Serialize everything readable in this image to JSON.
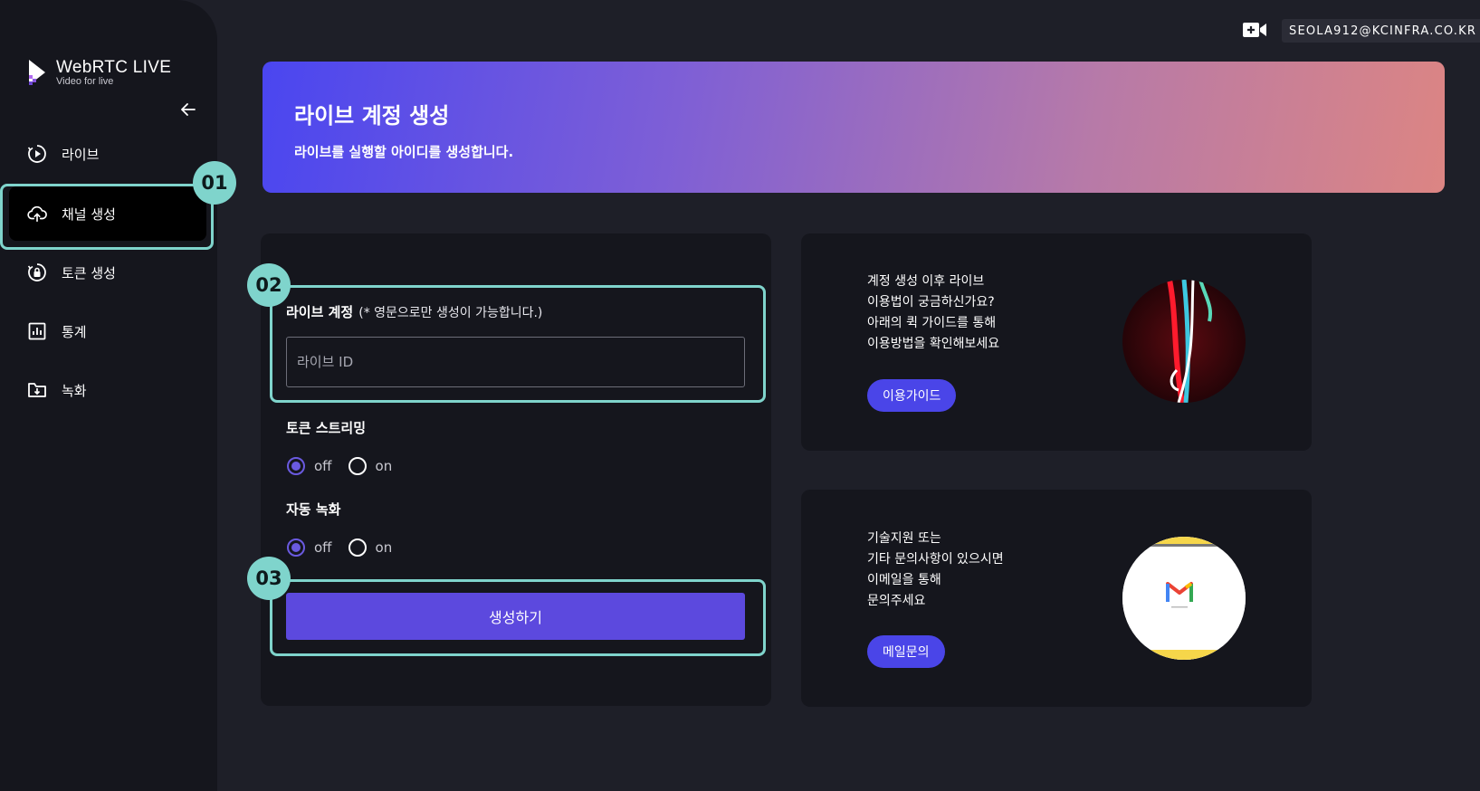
{
  "app": {
    "title": "WebRTC LIVE",
    "subtitle": "Video for live"
  },
  "sidebar": {
    "items": [
      {
        "label": "라이브",
        "icon": "play-circle-icon"
      },
      {
        "label": "채널 생성",
        "icon": "cloud-upload-icon"
      },
      {
        "label": "토큰 생성",
        "icon": "lock-refresh-icon"
      },
      {
        "label": "통계",
        "icon": "bar-chart-icon"
      },
      {
        "label": "녹화",
        "icon": "folder-download-icon"
      }
    ],
    "active_index": 1
  },
  "topbar": {
    "email": "SEOLA912@KCINFRA.CO.KR",
    "camera_icon": "video-add-icon"
  },
  "banner": {
    "title": "라이브 계정 생성",
    "description": "라이브를 실행할 아이디를 생성합니다."
  },
  "form": {
    "account_label": "라이브 계정",
    "account_note": "(* 영문으로만 생성이 가능합니다.)",
    "account_placeholder": "라이브 ID",
    "account_value": "",
    "token_streaming": {
      "label": "토큰 스트리밍",
      "options": [
        "off",
        "on"
      ],
      "selected": "off"
    },
    "auto_record": {
      "label": "자동 녹화",
      "options": [
        "off",
        "on"
      ],
      "selected": "off"
    },
    "submit_label": "생성하기"
  },
  "annotations": [
    "01",
    "02",
    "03"
  ],
  "guide_card": {
    "lines": [
      "계정 생성 이후 라이브",
      "이용법이 궁금하신가요?",
      "아래의 퀵 가이드를 통해",
      "이용방법을 확인해보세요"
    ],
    "button_label": "이용가이드"
  },
  "mail_card": {
    "lines": [
      "기술지원 또는",
      "기타 문의사항이 있으시면",
      "이메일을 통해",
      "문의주세요"
    ],
    "button_label": "메일문의"
  },
  "colors": {
    "accent": "#5c49de",
    "highlight": "#7fd4cc",
    "background": "#1e1f28",
    "panel": "#15161d"
  }
}
